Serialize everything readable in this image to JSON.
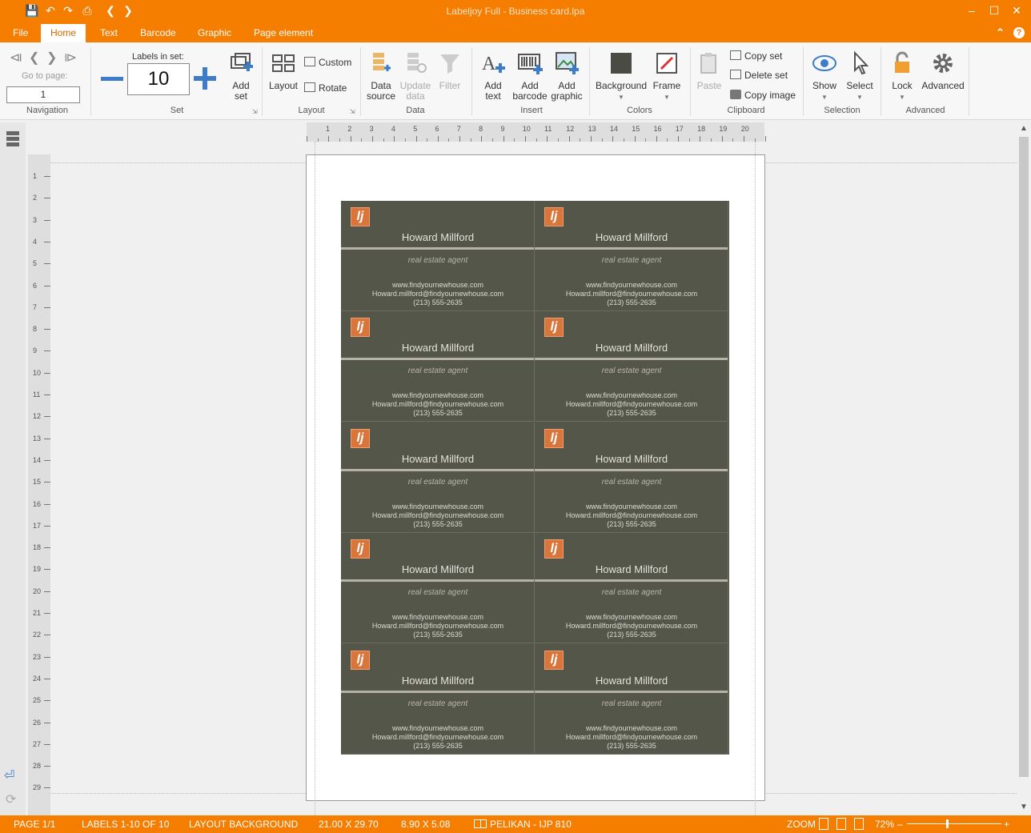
{
  "window": {
    "title": "Labeljoy Full - Business card.lpa"
  },
  "menu": {
    "tabs": [
      "File",
      "Home",
      "Text",
      "Barcode",
      "Graphic",
      "Page element"
    ],
    "active": "Home"
  },
  "ribbon": {
    "navigation": {
      "label": "Navigation",
      "goto_label": "Go to page:",
      "goto_value": "1"
    },
    "set": {
      "label": "Set",
      "labels_in_set_label": "Labels in set:",
      "labels_in_set_value": "10",
      "add_set": "Add set"
    },
    "layout": {
      "label": "Layout",
      "layout_btn": "Layout",
      "custom": "Custom",
      "rotate": "Rotate"
    },
    "data": {
      "label": "Data",
      "data_source": "Data source",
      "update_data": "Update data",
      "filter": "Filter"
    },
    "insert": {
      "label": "Insert",
      "add_text": "Add text",
      "add_barcode": "Add barcode",
      "add_graphic": "Add graphic"
    },
    "colors": {
      "label": "Colors",
      "background": "Background",
      "frame": "Frame",
      "background_color": "#4a4c44",
      "frame_color": "#e03030"
    },
    "clipboard": {
      "label": "Clipboard",
      "paste": "Paste",
      "copy_set": "Copy set",
      "delete_set": "Delete set",
      "copy_image": "Copy image"
    },
    "selection": {
      "label": "Selection",
      "show": "Show",
      "select": "Select"
    },
    "advanced": {
      "label": "Advanced",
      "lock": "Lock",
      "advanced": "Advanced"
    }
  },
  "card": {
    "logo_text": "lj",
    "name": "Howard Millford",
    "role": "real estate agent",
    "website": "www.findyournewhouse.com",
    "email": "Howard.millford@findyournewhouse.com",
    "phone": "(213) 555-2635"
  },
  "hruler_labels": [
    "1",
    "2",
    "3",
    "4",
    "5",
    "6",
    "7",
    "8",
    "9",
    "10",
    "11",
    "12",
    "13",
    "14",
    "15",
    "16",
    "17",
    "18",
    "19",
    "20"
  ],
  "vruler_labels": [
    "1",
    "2",
    "3",
    "4",
    "5",
    "6",
    "7",
    "8",
    "9",
    "10",
    "11",
    "12",
    "13",
    "14",
    "15",
    "16",
    "17",
    "18",
    "19",
    "20",
    "21",
    "22",
    "23",
    "24",
    "25",
    "26",
    "27",
    "28",
    "29"
  ],
  "status": {
    "page": "PAGE 1/1",
    "labels": "LABELS 1-10 OF 10",
    "layout": "LAYOUT BACKGROUND",
    "page_size": "21.00 X 29.70",
    "label_size": "8.90 X 5.08",
    "sheet": "PELIKAN - IJP 810",
    "zoom_label": "ZOOM",
    "zoom_value": "72%"
  }
}
